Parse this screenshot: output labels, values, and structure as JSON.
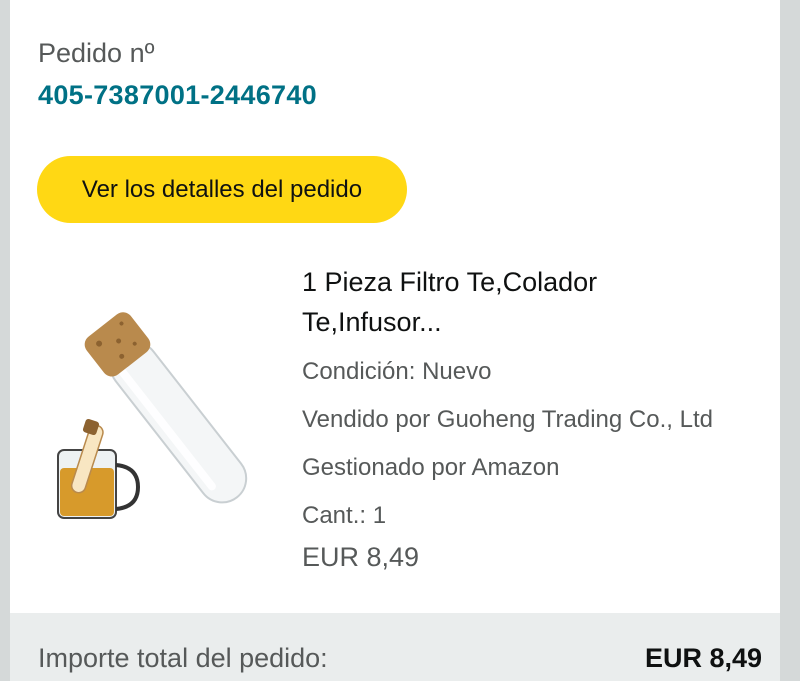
{
  "order": {
    "label": "Pedido nº",
    "number": "405-7387001-2446740",
    "details_button": "Ver los detalles del pedido"
  },
  "product": {
    "title_line1": "1 Pieza Filtro Te,Colador",
    "title_line2": "Te,Infusor...",
    "condition": "Condición: Nuevo",
    "seller": "Vendido por Guoheng Trading Co., Ltd",
    "fulfilled": "Gestionado por Amazon",
    "quantity": "Cant.: 1",
    "price": "EUR 8,49",
    "image_icon": "tea-infuser-tube-icon"
  },
  "summary": {
    "total_label": "Importe total del pedido:",
    "total_value": "EUR 8,49"
  },
  "colors": {
    "link": "#007185",
    "button": "#ffd814",
    "background": "#d5d9d9",
    "total_bar": "#eaeded"
  }
}
